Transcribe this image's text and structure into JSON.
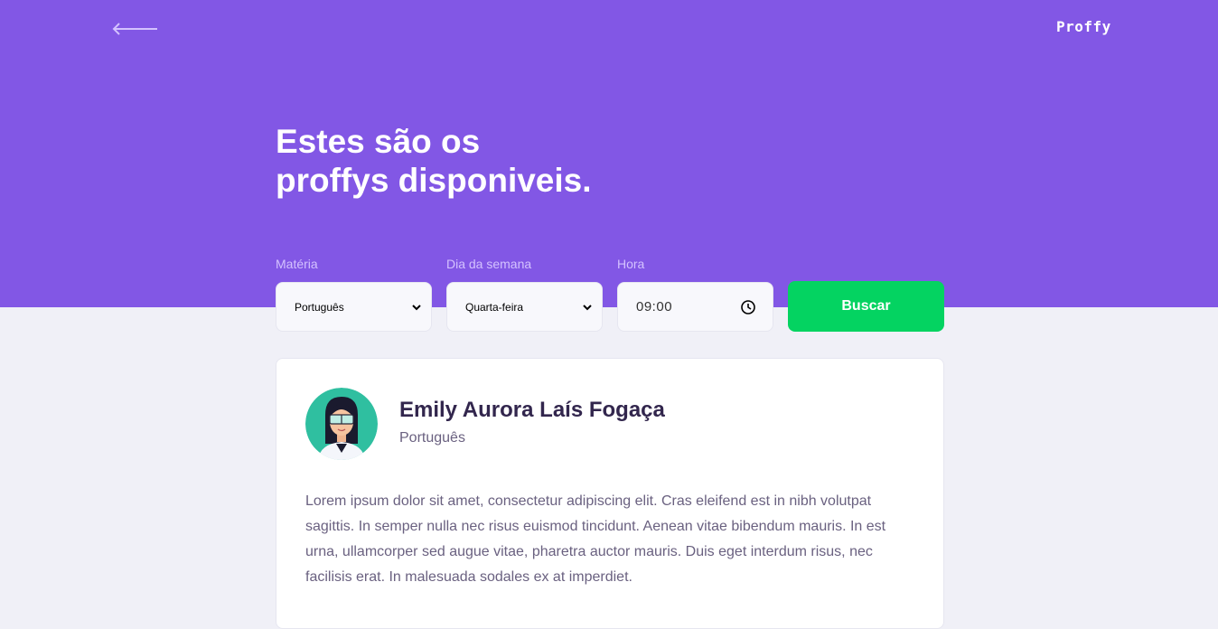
{
  "header": {
    "logo": "Proffy",
    "back_icon": "arrow-left-icon",
    "title_line1": "Estes são os",
    "title_line2": "proffys disponiveis."
  },
  "filters": {
    "subject": {
      "label": "Matéria",
      "value": "Português",
      "icon": "chevron-down-icon"
    },
    "weekday": {
      "label": "Dia da semana",
      "value": "Quarta-feira",
      "icon": "chevron-down-icon"
    },
    "time": {
      "label": "Hora",
      "value": "09:00",
      "icon": "clock-icon"
    },
    "submit_label": "Buscar"
  },
  "teacher": {
    "name": "Emily Aurora Laís Fogaça",
    "subject": "Português",
    "bio": "Lorem ipsum dolor sit amet, consectetur adipiscing elit. Cras eleifend est in nibh volutpat sagittis. In semper nulla nec risus euismod tincidunt. Aenean vitae bibendum mauris. In est urna, ullamcorper sed augue vitae, pharetra auctor mauris. Duis eget interdum risus, nec facilisis erat. In malesuada sodales ex at imperdiet."
  },
  "colors": {
    "primary": "#8257e5",
    "background": "#f0f0f7",
    "button": "#04d361",
    "label": "#d4c2ff",
    "title_text": "#32264d",
    "body_text": "#6a6180"
  }
}
